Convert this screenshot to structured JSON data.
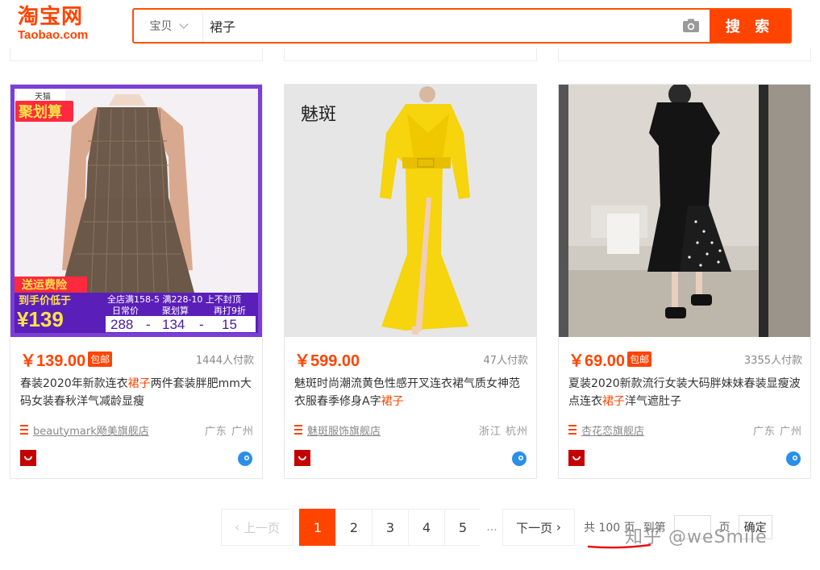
{
  "header": {
    "logo_cn": "淘宝网",
    "logo_en": "Taobao.com",
    "search_type": "宝贝",
    "search_query": "裙子",
    "search_button": "搜 索"
  },
  "products": [
    {
      "price": "￥139.00",
      "baoyou": "包邮",
      "sales": "1444人付款",
      "title_a": "春装2020年新款连衣",
      "title_hl": "裙子",
      "title_b": "两件套装胖肥mm大码女装春秋洋气减龄显瘦",
      "shop": "beautymark飏美旗舰店",
      "location": "广东 广州",
      "promo": {
        "tmall": "天猫",
        "juhuasuan": "聚划算",
        "shipping": "送运费险",
        "lowest": "到手价低于",
        "price": "¥139",
        "coupons": "全店满158-5 满228-10 上不封顶",
        "label1": "日常价",
        "label2": "聚划算",
        "label3": "再打9折",
        "v1": "288",
        "v2": "134",
        "v3": "15"
      }
    },
    {
      "price": "￥599.00",
      "baoyou": "",
      "sales": "47人付款",
      "title_a": "魅斑时尚潮流黄色性感开叉连衣裙气质女神范衣服春季修身A字",
      "title_hl": "裙子",
      "title_b": "",
      "shop": "魅斑服饰旗舰店",
      "location": "浙江 杭州",
      "brand": "魅斑"
    },
    {
      "price": "￥69.00",
      "baoyou": "包邮",
      "sales": "3355人付款",
      "title_a": "夏装2020新款流行女装大码胖妹妹春装显瘦波点连衣",
      "title_hl": "裙子",
      "title_b": "洋气遮肚子",
      "shop": "杏花恋旗舰店",
      "location": "广东 广州"
    }
  ],
  "pagination": {
    "prev": "上一页",
    "pages": [
      "1",
      "2",
      "3",
      "4",
      "5"
    ],
    "current": "1",
    "dots": "...",
    "next": "下一页",
    "total": "共 100 页",
    "goto": "到第",
    "page_unit": "页",
    "confirm": "确定"
  },
  "watermark": "知乎 @weSmile",
  "colors": {
    "accent": "#ff4400"
  }
}
